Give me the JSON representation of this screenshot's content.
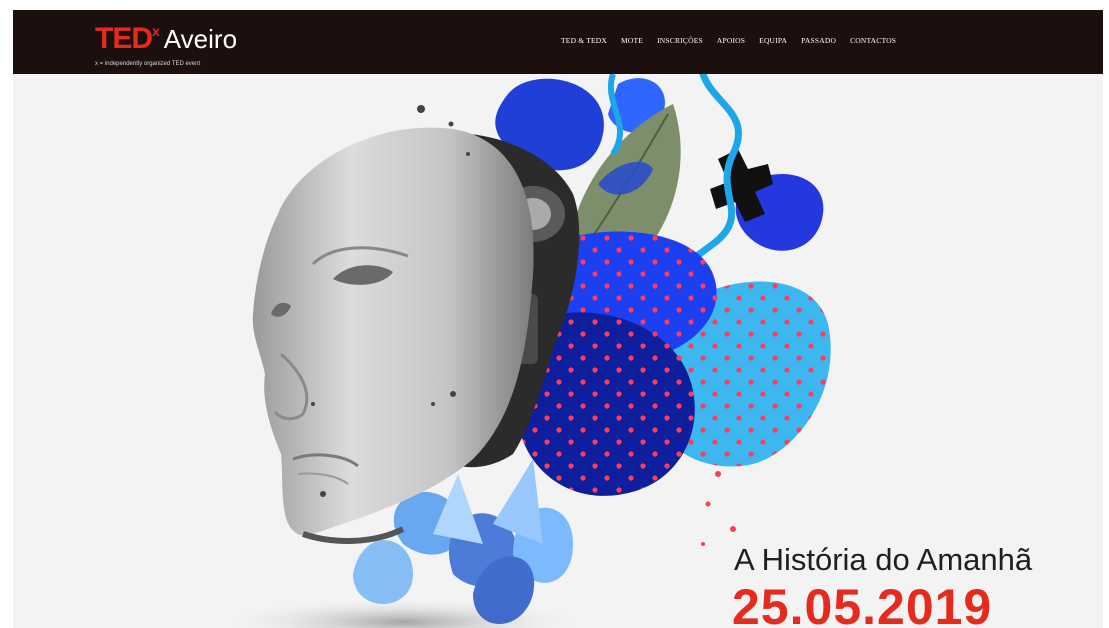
{
  "brand": {
    "ted": "TED",
    "x": "x",
    "city": "Aveiro",
    "tagline": "x = independently organized TED event",
    "colors": {
      "red": "#e62b1e",
      "nav_bg": "#1c0f0d"
    }
  },
  "nav": {
    "items": [
      {
        "label": "TED & TEDX"
      },
      {
        "label": "MOTE"
      },
      {
        "label": "INSCRIÇÕES"
      },
      {
        "label": "APOIOS"
      },
      {
        "label": "EQUIPA"
      },
      {
        "label": "PASSADO"
      },
      {
        "label": "CONTACTOS"
      }
    ]
  },
  "hero": {
    "subtitle": "A História do Amanhã",
    "date": "25.05.2019",
    "image": "robot-head-with-abstract-blue-floral-collage"
  }
}
